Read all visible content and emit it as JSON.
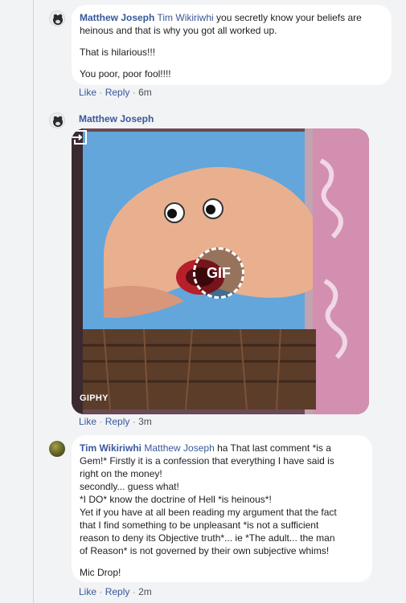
{
  "comments": [
    {
      "author": "Matthew Joseph",
      "mention": "Tim Wikiriwhi",
      "text_first": "you secretly know your beliefs are heinous and that is why you got all worked up.",
      "paragraphs": [
        "That is hilarious!!!",
        "You poor, poor fool!!!!"
      ],
      "actions": {
        "like": "Like",
        "reply": "Reply",
        "time": "6m"
      }
    },
    {
      "author": "Matthew Joseph",
      "gif": {
        "badge": "GIF",
        "source": "GIPHY"
      },
      "actions": {
        "like": "Like",
        "reply": "Reply",
        "time": "3m"
      }
    },
    {
      "author": "Tim Wikiriwhi",
      "mention": "Matthew Joseph",
      "lines": [
        "ha That last comment *is a",
        "Gem!* Firstly it is a confession that everything I have said is",
        "right on the money!",
        "secondly... guess what!",
        "*I DO* know the doctrine of Hell *is heinous*!",
        "Yet if you have at all been reading my argument that the fact",
        "that I find something to be unpleasant *is not a sufficient",
        "reason to deny its Objective truth*... ie *The adult... the man",
        "of Reason* is not governed by their own subjective whims!"
      ],
      "closing": "Mic Drop!",
      "actions": {
        "like": "Like",
        "reply": "Reply",
        "time": "2m"
      }
    }
  ],
  "separator": "·",
  "colors": {
    "link": "#385898",
    "meta": "#90949c",
    "background": "#f2f3f5"
  }
}
